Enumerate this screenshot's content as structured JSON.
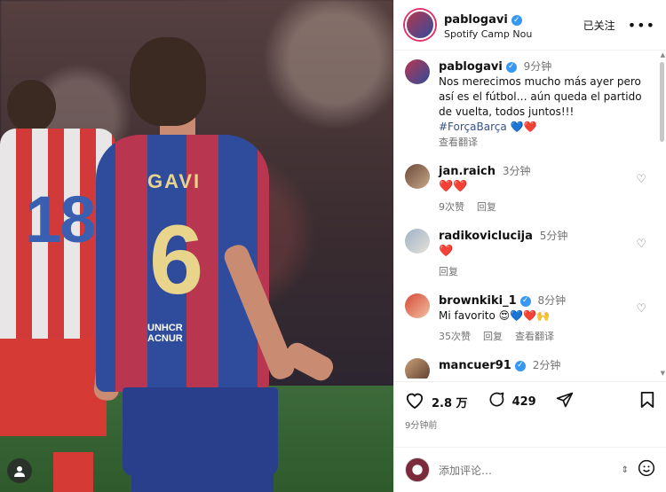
{
  "header": {
    "username": "pablogavi",
    "location": "Spotify Camp Nou",
    "follow_label": "已关注",
    "more": "•••"
  },
  "caption": {
    "username": "pablogavi",
    "time": "9分钟",
    "text": "Nos merecimos mucho más ayer pero así es el fútbol… aún queda el partido de vuelta, todos juntos!!!",
    "hashtag": "#ForçaBarça",
    "emoji": "💙❤️",
    "translate": "查看翻译"
  },
  "comments": [
    {
      "username": "jan.raich",
      "time": "3分钟",
      "text": "❤️❤️",
      "likes": "9次赞",
      "reply": "回复",
      "translate": ""
    },
    {
      "username": "radikoviclucija",
      "time": "5分钟",
      "text": "❤️",
      "likes": "",
      "reply": "回复",
      "translate": ""
    },
    {
      "username": "brownkiki_1",
      "time": "8分钟",
      "text": "Mi favorito 😍💙❤️🙌",
      "likes": "35次赞",
      "reply": "回复",
      "translate": "查看翻译"
    },
    {
      "username": "mancuer91",
      "time": "2分钟",
      "text": "",
      "likes": "",
      "reply": "",
      "translate": ""
    }
  ],
  "actions": {
    "like_count": "2.8 万",
    "comment_count": "429",
    "posted": "9分钟前"
  },
  "composer": {
    "placeholder": "添加评论…"
  },
  "photo": {
    "rival_number": "18",
    "player_name": "GAVI",
    "player_number": "6",
    "sponsor_line1": "UNHCR",
    "sponsor_line2": "ACNUR"
  },
  "colors": {
    "verified": "#3897f0",
    "heart": "#e0234a",
    "link": "#385185",
    "muted": "#737373"
  }
}
